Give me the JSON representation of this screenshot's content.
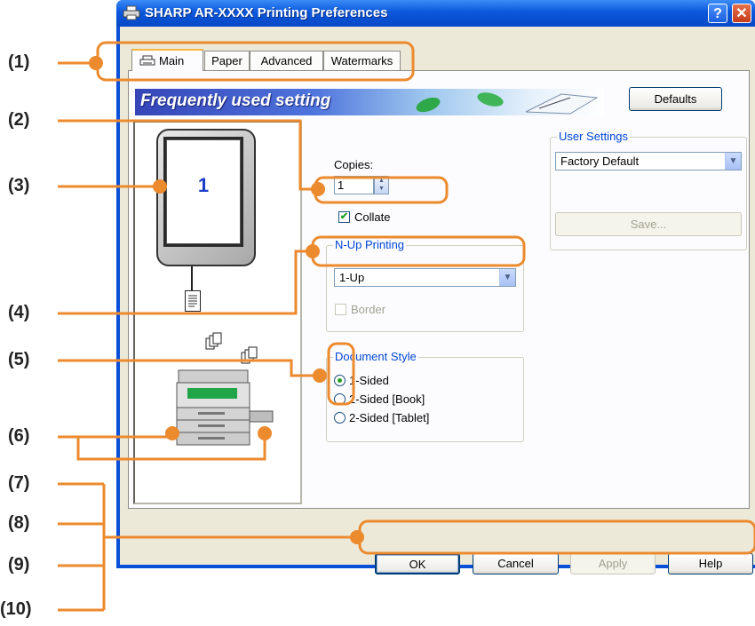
{
  "window": {
    "title": "SHARP AR-XXXX Printing Preferences",
    "help_glyph": "?",
    "close_glyph": "✕"
  },
  "tabs": [
    {
      "label": "Main",
      "selected": true
    },
    {
      "label": "Paper",
      "selected": false
    },
    {
      "label": "Advanced",
      "selected": false
    },
    {
      "label": "Watermarks",
      "selected": false
    }
  ],
  "banner": {
    "text": "Frequently used setting"
  },
  "defaults_button": "Defaults",
  "preview": {
    "page_number": "1"
  },
  "copies": {
    "label": "Copies:",
    "value": "1"
  },
  "collate": {
    "label": "Collate",
    "checked": true
  },
  "nup": {
    "group_label": "N-Up Printing",
    "value": "1-Up",
    "border_label": "Border",
    "border_enabled": false
  },
  "document_style": {
    "group_label": "Document Style",
    "options": [
      {
        "label": "1-Sided",
        "selected": true
      },
      {
        "label": "2-Sided [Book]",
        "selected": false
      },
      {
        "label": "2-Sided [Tablet]",
        "selected": false
      }
    ]
  },
  "user_settings": {
    "group_label": "User Settings",
    "value": "Factory Default",
    "save_label": "Save..."
  },
  "buttons": {
    "ok": "OK",
    "cancel": "Cancel",
    "apply": "Apply",
    "help": "Help"
  },
  "callouts": [
    "(1)",
    "(2)",
    "(3)",
    "(4)",
    "(5)",
    "(6)",
    "(7)",
    "(8)",
    "(9)",
    "(10)"
  ],
  "colors": {
    "callout_orange": "#ec8a2e",
    "title_blue": "#0a57dd",
    "accent_green": "#21a121"
  }
}
